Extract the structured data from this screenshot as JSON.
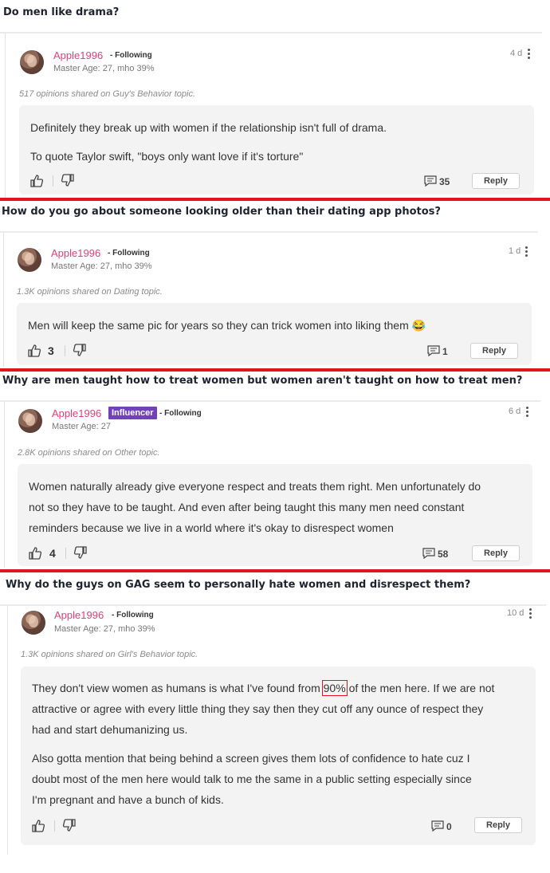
{
  "posts": [
    {
      "question": "Do men like drama?",
      "username": "Apple1996",
      "following": "- Following",
      "badge": "",
      "meta": "Master Age: 27, mho 39%",
      "age": "4 d",
      "shared": "517 opinions shared on Guy's Behavior topic.",
      "paragraphs": [
        "Definitely they break up with women if the relationship isn't full of drama.",
        "To quote Taylor swift, \"boys only want love if it's torture\""
      ],
      "upvotes": "",
      "comments": "35",
      "reply": "Reply"
    },
    {
      "question": "How do you go about someone looking older than their dating app photos?",
      "username": "Apple1996",
      "following": "- Following",
      "badge": "",
      "meta": "Master Age: 27, mho 39%",
      "age": "1 d",
      "shared": "1.3K opinions shared on Dating topic.",
      "paragraphs": [
        "Men will keep the same pic for years so they can trick women into liking them 😂"
      ],
      "upvotes": "3",
      "comments": "1",
      "reply": "Reply"
    },
    {
      "question": "Why are men taught how to treat women but women aren't taught on how to treat men?",
      "username": "Apple1996",
      "following": "- Following",
      "badge": "Influencer",
      "meta": "Master Age: 27",
      "age": "6 d",
      "shared": "2.8K opinions shared on Other topic.",
      "paragraphs": [
        "Women naturally already give everyone respect and treats them right. Men unfortunately do",
        "not so they have to be taught. And even after being taught this many men need constant",
        "reminders because we live in a world where it's okay to disrespect women"
      ],
      "upvotes": "4",
      "comments": "58",
      "reply": "Reply"
    },
    {
      "question": "Why do the guys on GAG seem to personally hate women and disrespect them?",
      "username": "Apple1996",
      "following": "- Following",
      "badge": "",
      "meta": "Master Age: 27, mho 39%",
      "age": "10 d",
      "shared": "1.3K opinions shared on Girl's Behavior topic.",
      "paragraphs": [
        "They don't view women as humans is what I've found from",
        "90%",
        "of the men here. If we are not",
        "attractive or agree with every little thing they say then they cut off any ounce of respect they",
        "had and start dehumanizing us.",
        "Also gotta mention that being behind a screen gives them lots of confidence to hate cuz I",
        "doubt most of the men here would talk to me the same in a public setting especially since",
        "I'm pregnant and have a bunch of kids."
      ],
      "upvotes": "",
      "comments": "0",
      "reply": "Reply"
    }
  ],
  "colors": {
    "username": "#e03f76",
    "badge": "#7041b8",
    "divider": "#e2141e"
  },
  "icons": [
    "thumbs-up-icon",
    "thumbs-down-icon",
    "comment-icon",
    "more-vert-icon"
  ]
}
